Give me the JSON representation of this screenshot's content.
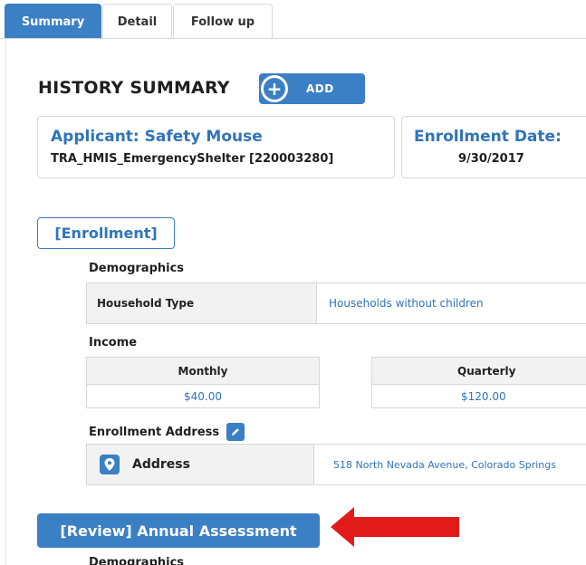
{
  "tabs": [
    {
      "label": "Summary",
      "active": true
    },
    {
      "label": "Detail",
      "active": false
    },
    {
      "label": "Follow up",
      "active": false
    }
  ],
  "header": {
    "title": "HISTORY SUMMARY",
    "add_label": "ADD"
  },
  "cards": {
    "applicant_title": "Applicant: Safety Mouse",
    "applicant_sub": "TRA_HMIS_EmergencyShelter [220003280]",
    "enrollment_title": "Enrollment Date:",
    "enrollment_date": "9/30/2017"
  },
  "enrollment": {
    "button_label": "[Enrollment]",
    "demographics_label": "Demographics",
    "household_key": "Household Type",
    "household_value": "Households without children",
    "income_label": "Income",
    "monthly_header": "Monthly",
    "monthly_value": "$40.00",
    "quarterly_header": "Quarterly",
    "quarterly_value": "$120.00",
    "address_label": "Enrollment Address",
    "address_key": "Address",
    "address_value": "518 North Nevada Avenue, Colorado Springs"
  },
  "review": {
    "button_label": "[Review] Annual Assessment",
    "demographics_label": "Demographics"
  },
  "colors": {
    "accent": "#3b7fc4",
    "link": "#2f74b9",
    "arrow": "#e11b1b"
  },
  "icons": {
    "add": "plus-circle-icon",
    "edit": "pencil-icon",
    "address": "map-pin-icon",
    "annotation": "red-arrow-icon"
  }
}
